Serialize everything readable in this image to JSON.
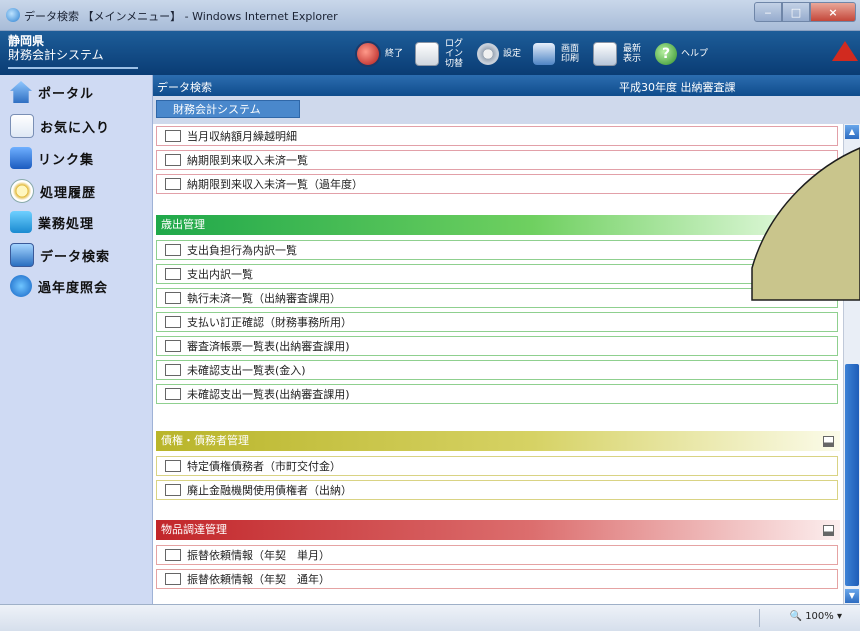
{
  "window": {
    "title": "データ検索 【メインメニュー】 - Windows Internet Explorer",
    "minimize": "‒",
    "maximize": "□",
    "close": "×"
  },
  "app": {
    "logo_line1": "静岡県",
    "logo_line2": "財務会計システム",
    "toolbar": [
      {
        "icon": "exit-icon",
        "label": "終了"
      },
      {
        "icon": "login-switch-icon",
        "label": "ログイン切替"
      },
      {
        "icon": "settings-icon",
        "label": "設定"
      },
      {
        "icon": "screen-print-icon",
        "label": "画面印刷"
      },
      {
        "icon": "refresh-display-icon",
        "label": "最新表示"
      },
      {
        "icon": "help-icon",
        "label": "ヘルプ"
      }
    ]
  },
  "nav": [
    {
      "icon": "home-icon",
      "label": "ポータル"
    },
    {
      "icon": "favorites-icon",
      "label": "お気に入り"
    },
    {
      "icon": "links-icon",
      "label": "リンク集"
    },
    {
      "icon": "history-icon",
      "label": "処理履歴"
    },
    {
      "icon": "business-icon",
      "label": "業務処理"
    },
    {
      "icon": "data-search-icon",
      "label": "データ検索"
    },
    {
      "icon": "past-year-icon",
      "label": "過年度照会"
    }
  ],
  "header": {
    "breadcrumb": "データ検索",
    "context": "平成30年度 出納審査課"
  },
  "system_tab": "財務会計システム",
  "list": {
    "top_rows": [
      "当月収納額月繰越明細",
      "納期限到来収入未済一覧",
      "納期限到来収入未済一覧（過年度）"
    ],
    "sections": [
      {
        "title": "歳出管理",
        "items": [
          "支出負担行為内訳一覧",
          "支出内訳一覧",
          "執行未済一覧（出納審査課用）",
          "支払い訂正確認（財務事務所用）",
          "審査済帳票一覧表(出納審査課用)",
          "未確認支出一覧表(金入)",
          "未確認支出一覧表(出納審査課用)"
        ]
      },
      {
        "title": "債権・債務者管理",
        "items": [
          "特定債権債務者（市町交付金）",
          "廃止金融機関使用債権者（出納）"
        ]
      },
      {
        "title": "物品調達管理",
        "items": [
          "振替依頼情報（年契　単月）",
          "振替依頼情報（年契　通年）"
        ]
      }
    ]
  },
  "status": {
    "zoom": "100%",
    "zoom_icon": "zoom-icon"
  },
  "colors": {
    "header_blue": "#0a3c74",
    "section_green": "#1fa84a",
    "section_olive": "#b9b52a",
    "section_red": "#c2262a",
    "overlay_fill": "#c9c58c"
  }
}
